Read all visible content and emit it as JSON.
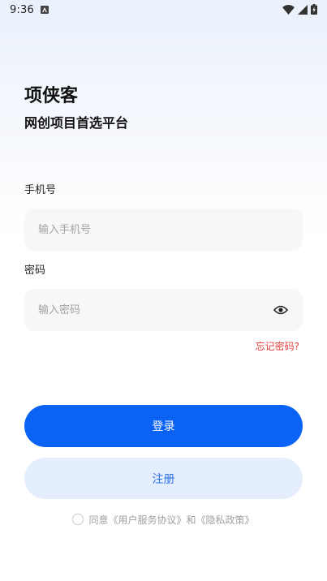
{
  "status_bar": {
    "time": "9:36"
  },
  "brand": {
    "title": "项侠客",
    "subtitle": "网创项目首选平台"
  },
  "phone": {
    "label": "手机号",
    "placeholder": "输入手机号"
  },
  "password": {
    "label": "密码",
    "placeholder": "输入密码"
  },
  "forgot_password": "忘记密码?",
  "login_label": "登录",
  "register_label": "注册",
  "agreement": {
    "prefix": "同意",
    "user_agreement": "《用户服务协议》",
    "conjunction": "和",
    "privacy_policy": "《隐私政策》"
  },
  "colors": {
    "primary": "#0a63f5",
    "secondary_bg": "#e4eefd",
    "link_red": "#e23b3b"
  }
}
